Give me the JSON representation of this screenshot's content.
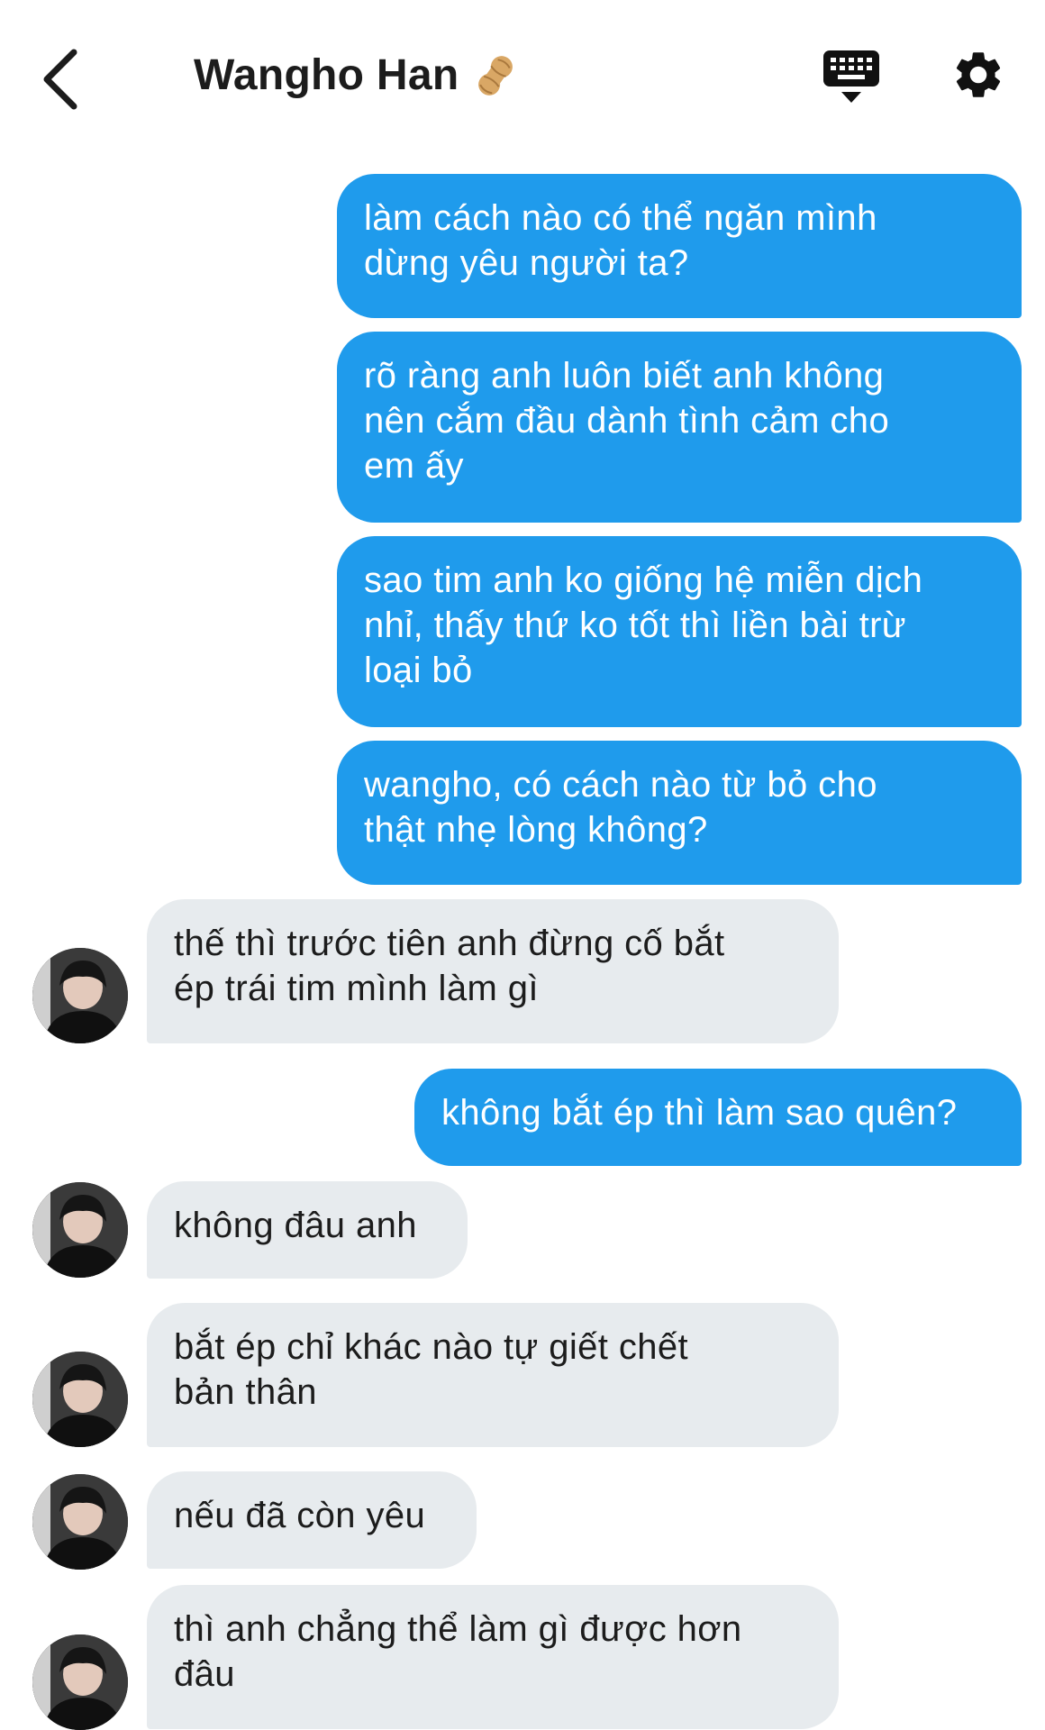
{
  "header": {
    "contact_name": "Wangho Han",
    "name_emoji": "peanut-emoji",
    "back_icon": "chevron-left-icon",
    "keyboard_icon": "keyboard-icon",
    "settings_icon": "gear-icon"
  },
  "colors": {
    "sent_bubble": "#1f9bec",
    "received_bubble": "#e7ebee",
    "text_dark": "#1c1c1c"
  },
  "messages": [
    {
      "from": "me",
      "text": "làm cách nào có thể ngăn mình\ndừng yêu người ta?"
    },
    {
      "from": "me",
      "text": "rõ ràng anh luôn biết anh không\nnên cắm đầu dành tình cảm cho\nem ấy"
    },
    {
      "from": "me",
      "text": "sao tim anh ko giống hệ miễn dịch\nnhỉ, thấy thứ ko tốt thì liền bài trừ\nloại bỏ"
    },
    {
      "from": "me",
      "text": "wangho, có cách nào từ bỏ cho\nthật nhẹ lòng không?"
    },
    {
      "from": "them",
      "text": "thế thì trước tiên anh đừng cố bắt\nép trái tim mình làm gì"
    },
    {
      "from": "me",
      "text": "không bắt ép thì làm sao quên?"
    },
    {
      "from": "them",
      "text": "không đâu anh"
    },
    {
      "from": "them",
      "text": "bắt ép chỉ khác nào tự giết chết\nbản thân"
    },
    {
      "from": "them",
      "text": "nếu đã còn yêu"
    },
    {
      "from": "them",
      "text": "thì anh chẳng thể làm gì được hơn\nđâu"
    }
  ]
}
